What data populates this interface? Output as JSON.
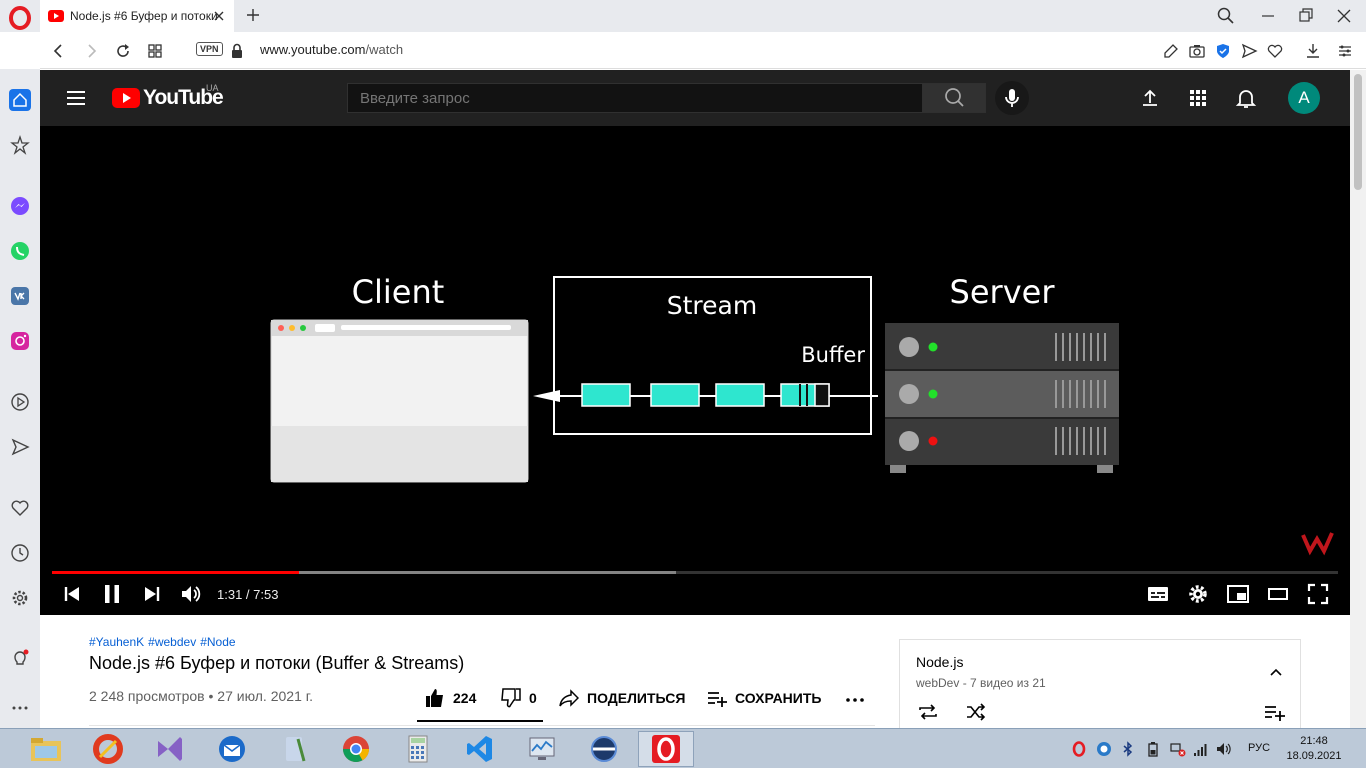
{
  "browser": {
    "tab_title": "Node.js #6 Буфер и потоки (Buffer & Streams)",
    "url_host": "www.youtube.com",
    "url_path": "/watch",
    "vpn_label": "VPN"
  },
  "youtube": {
    "logo_text": "YouTube",
    "country": "UA",
    "search_placeholder": "Введите запрос",
    "avatar_letter": "A"
  },
  "video": {
    "client_label": "Client",
    "stream_label": "Stream",
    "server_label": "Server",
    "buffer_label": "Buffer",
    "time_display": "1:31 / 7:53",
    "progress_played": 0.192,
    "progress_loaded": 0.485
  },
  "details": {
    "hashtags": [
      "#YauhenK",
      "#webdev",
      "#Node"
    ],
    "title": "Node.js #6 Буфер и потоки (Buffer & Streams)",
    "views_date": "2 248 просмотров • 27 июл. 2021 г.",
    "likes": "224",
    "dislikes": "0",
    "share_label": "ПОДЕЛИТЬСЯ",
    "save_label": "СОХРАНИТЬ"
  },
  "playlist": {
    "title": "Node.js",
    "subtitle": "webDev - 7 видео из 21"
  },
  "taskbar": {
    "language": "РУС",
    "time": "21:48",
    "date": "18.09.2021"
  },
  "colors": {
    "yt_red": "#ff0000",
    "opera_red": "#e51c23",
    "buffer_cyan": "#2ee6cf",
    "led_green": "#22e02a",
    "led_red": "#ee1111"
  }
}
